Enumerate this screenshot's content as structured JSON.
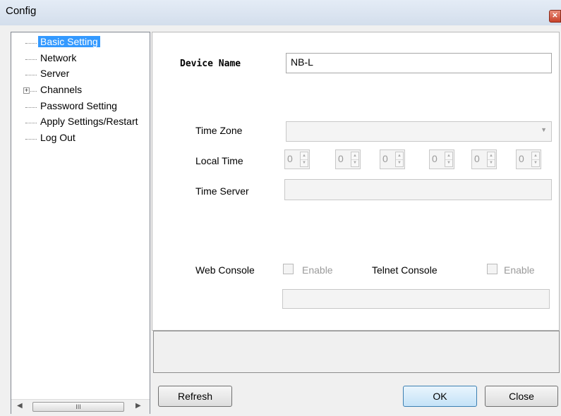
{
  "window": {
    "title": "Config"
  },
  "tree": {
    "items": [
      {
        "label": "Basic Setting",
        "selected": true,
        "expandable": false
      },
      {
        "label": "Network",
        "selected": false,
        "expandable": false
      },
      {
        "label": "Server",
        "selected": false,
        "expandable": false
      },
      {
        "label": "Channels",
        "selected": false,
        "expandable": true
      },
      {
        "label": "Password Setting",
        "selected": false,
        "expandable": false
      },
      {
        "label": "Apply Settings/Restart",
        "selected": false,
        "expandable": false
      },
      {
        "label": "Log Out",
        "selected": false,
        "expandable": false
      }
    ],
    "scroll_thumb_glyph": "III"
  },
  "basic": {
    "device_name_label": "Device Name",
    "device_name_value": "NB-L",
    "time_zone_label": "Time Zone",
    "time_zone_value": "",
    "local_time_label": "Local Time",
    "local_time_values": [
      "0",
      "0",
      "0",
      "0",
      "0",
      "0"
    ],
    "time_server_label": "Time Server",
    "time_server_value": "",
    "web_console_label": "Web Console",
    "web_console_enable_label": "Enable",
    "telnet_console_label": "Telnet Console",
    "telnet_console_enable_label": "Enable",
    "extra_field_value": ""
  },
  "buttons": {
    "refresh": "Refresh",
    "ok": "OK",
    "close": "Close"
  },
  "icons": {
    "close": "close-icon",
    "expand": "expand-plus-icon",
    "scroll_left": "scroll-left-arrow-icon",
    "scroll_right": "scroll-right-arrow-icon",
    "combo_arrow": "chevron-down-icon",
    "spin": "spin-updown-icon"
  },
  "colors": {
    "selection": "#3399ff",
    "ok_button": "#c4e2f7",
    "close_button": "#c8422b"
  }
}
